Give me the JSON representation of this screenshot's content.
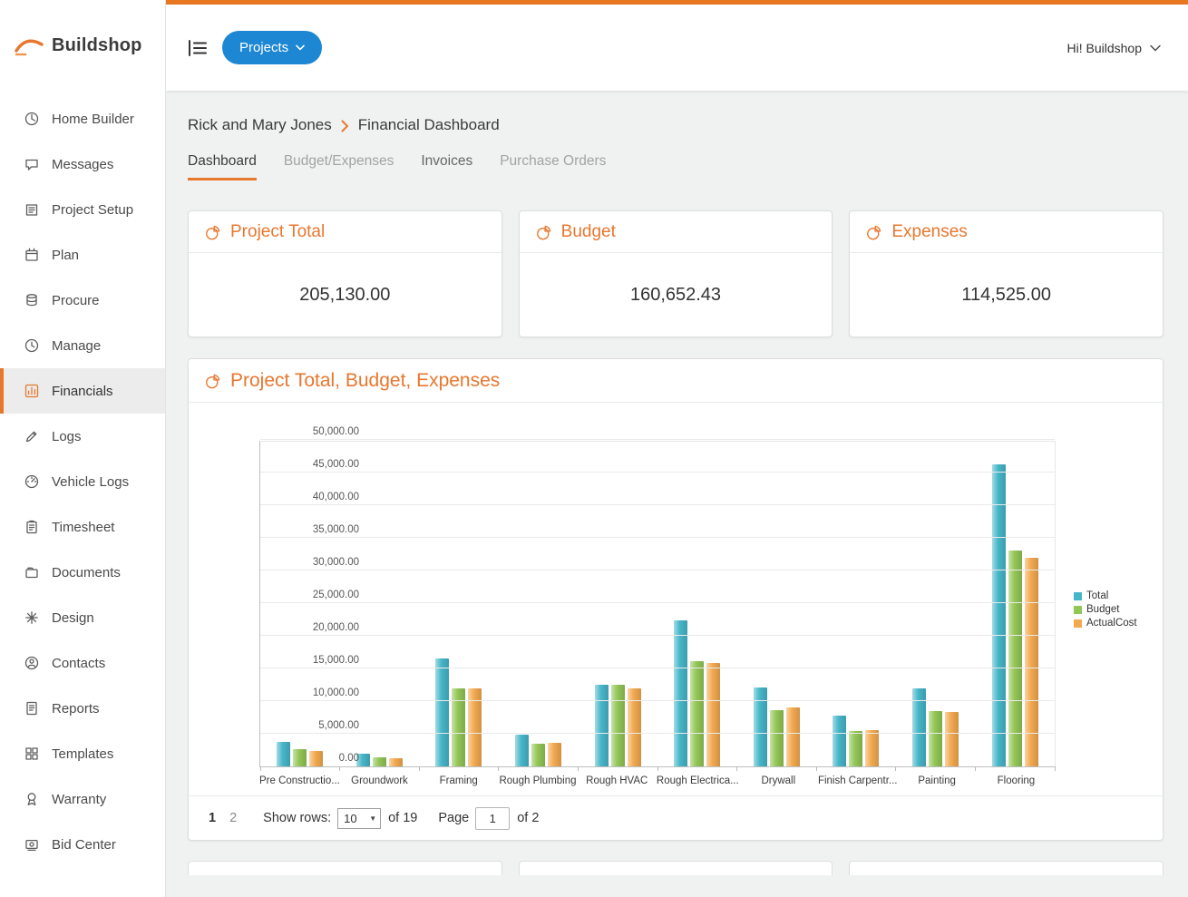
{
  "brand": {
    "name": "Buildshop"
  },
  "topbar": {
    "projects_label": "Projects",
    "greeting": "Hi! Buildshop"
  },
  "sidebar": {
    "items": [
      {
        "label": "Home Builder",
        "icon": "home-builder",
        "active": false
      },
      {
        "label": "Messages",
        "icon": "messages",
        "active": false
      },
      {
        "label": "Project Setup",
        "icon": "project-setup",
        "active": false
      },
      {
        "label": "Plan",
        "icon": "plan",
        "active": false
      },
      {
        "label": "Procure",
        "icon": "procure",
        "active": false
      },
      {
        "label": "Manage",
        "icon": "manage",
        "active": false
      },
      {
        "label": "Financials",
        "icon": "financials",
        "active": true
      },
      {
        "label": "Logs",
        "icon": "logs",
        "active": false
      },
      {
        "label": "Vehicle Logs",
        "icon": "vehicle-logs",
        "active": false
      },
      {
        "label": "Timesheet",
        "icon": "timesheet",
        "active": false
      },
      {
        "label": "Documents",
        "icon": "documents",
        "active": false
      },
      {
        "label": "Design",
        "icon": "design",
        "active": false
      },
      {
        "label": "Contacts",
        "icon": "contacts",
        "active": false
      },
      {
        "label": "Reports",
        "icon": "reports",
        "active": false
      },
      {
        "label": "Templates",
        "icon": "templates",
        "active": false
      },
      {
        "label": "Warranty",
        "icon": "warranty",
        "active": false
      },
      {
        "label": "Bid Center",
        "icon": "bid-center",
        "active": false
      }
    ]
  },
  "breadcrumb": {
    "project": "Rick and Mary Jones",
    "page": "Financial Dashboard"
  },
  "tabs": [
    {
      "label": "Dashboard",
      "state": "active"
    },
    {
      "label": "Budget/Expenses",
      "state": "muted"
    },
    {
      "label": "Invoices",
      "state": "default"
    },
    {
      "label": "Purchase Orders",
      "state": "muted"
    }
  ],
  "summary_cards": [
    {
      "title": "Project Total",
      "value": "205,130.00",
      "icon": "pie-chart"
    },
    {
      "title": "Budget",
      "value": "160,652.43",
      "icon": "pie-chart"
    },
    {
      "title": "Expenses",
      "value": "114,525.00",
      "icon": "pie-chart"
    }
  ],
  "colors": {
    "accent_orange": "#e8772e",
    "top_strip": "#e87722",
    "button_blue": "#1d87d3",
    "bar_total": "#45b6c8",
    "bar_budget": "#92c655",
    "bar_actual": "#f2a94f"
  },
  "chart_data": {
    "type": "bar",
    "title": "Project Total, Budget, Expenses",
    "categories": [
      "Pre Constructio...",
      "Groundwork",
      "Framing",
      "Rough Plumbing",
      "Rough HVAC",
      "Rough Electrica...",
      "Drywall",
      "Finish Carpentr...",
      "Painting",
      "Flooring"
    ],
    "series": [
      {
        "name": "Total",
        "color": "#45b6c8",
        "values": [
          3800,
          2000,
          16500,
          4900,
          12500,
          22400,
          12100,
          7800,
          11900,
          46300
        ]
      },
      {
        "name": "Budget",
        "color": "#92c655",
        "values": [
          2700,
          1400,
          11900,
          3500,
          12500,
          16100,
          8600,
          5400,
          8500,
          33000
        ]
      },
      {
        "name": "ActualCost",
        "color": "#f2a94f",
        "values": [
          2300,
          1200,
          12000,
          3600,
          11900,
          15900,
          9000,
          5500,
          8400,
          31900
        ]
      }
    ],
    "ylim": [
      0,
      50000
    ],
    "ytick_step": 5000,
    "ytick_labels": [
      "0.00",
      "5,000.00",
      "10,000.00",
      "15,000.00",
      "20,000.00",
      "25,000.00",
      "30,000.00",
      "35,000.00",
      "40,000.00",
      "45,000.00",
      "50,000.00"
    ],
    "grid": true,
    "legend_position": "right"
  },
  "pagination": {
    "pages": [
      "1",
      "2"
    ],
    "current_page": "1",
    "show_rows_label": "Show rows:",
    "rows_value": "10",
    "rows_total": "of 19",
    "page_label": "Page",
    "page_value": "1",
    "pages_total": "of 2"
  }
}
